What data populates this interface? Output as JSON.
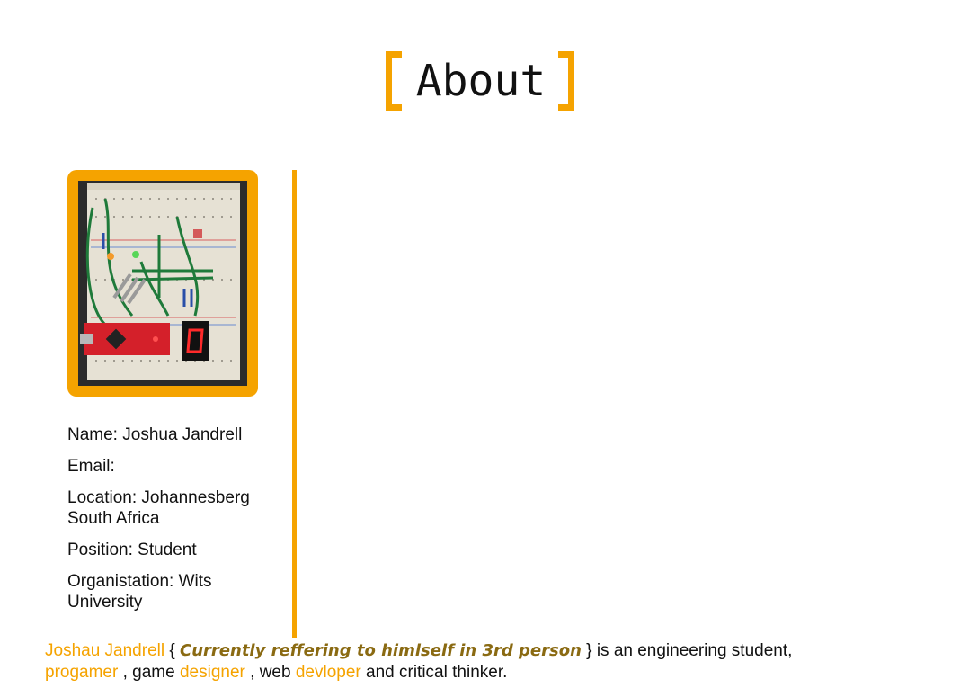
{
  "heading": {
    "title": "About"
  },
  "profile": {
    "photo_alt": "breadboard-circuit-photo"
  },
  "info": [
    {
      "label": "Name:",
      "value": "Joshua Jandrell"
    },
    {
      "label": "Email:",
      "value": ""
    },
    {
      "label": "Location:",
      "value": "Johannesberg South Africa"
    },
    {
      "label": "Position:",
      "value": "Student"
    },
    {
      "label": "Organistation:",
      "value": "Wits University"
    }
  ],
  "bio": {
    "name": "Joshau Jandrell",
    "brace_open": "{",
    "aside": "Currently reffering to himlself in 3rd person",
    "brace_close": "}",
    "text1": "is an engineering student,",
    "role1": "progamer",
    "text2": ", game",
    "role2": "designer",
    "text3": ", web",
    "role3": "devloper",
    "text4": "and critical thinker."
  },
  "colors": {
    "accent": "#f5a300",
    "aside": "#8a6a12",
    "text": "#111111"
  }
}
